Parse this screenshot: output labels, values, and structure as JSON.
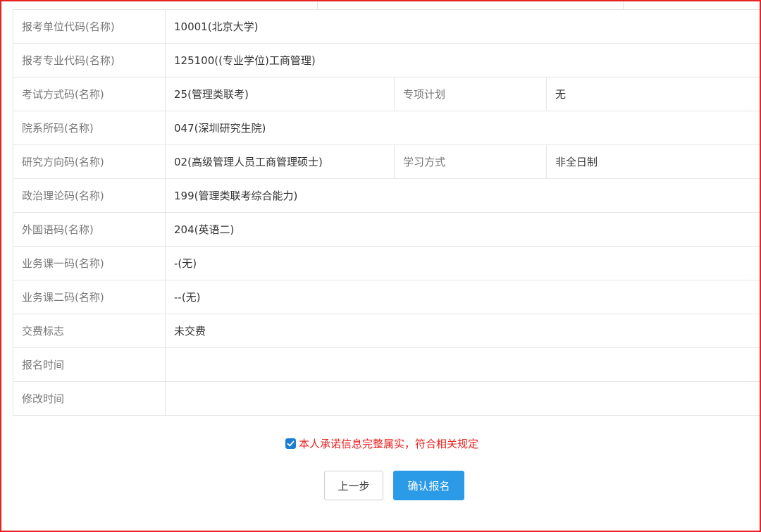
{
  "rows": [
    {
      "label": "报考单位代码(名称)",
      "value": "10001(北京大学)"
    },
    {
      "label": "报考专业代码(名称)",
      "value": "125100((专业学位)工商管理)"
    },
    {
      "label": "考试方式码(名称)",
      "value": "25(管理类联考)",
      "label2": "专项计划",
      "value2": "无"
    },
    {
      "label": "院系所码(名称)",
      "value": "047(深圳研究生院)"
    },
    {
      "label": "研究方向码(名称)",
      "value": "02(高级管理人员工商管理硕士)",
      "label2": "学习方式",
      "value2": "非全日制"
    },
    {
      "label": "政治理论码(名称)",
      "value": "199(管理类联考综合能力)"
    },
    {
      "label": "外国语码(名称)",
      "value": "204(英语二)"
    },
    {
      "label": "业务课一码(名称)",
      "value": "-(无)"
    },
    {
      "label": "业务课二码(名称)",
      "value": "--(无)"
    },
    {
      "label": "交费标志",
      "value": "未交费"
    },
    {
      "label": "报名时间",
      "value": ""
    },
    {
      "label": "修改时间",
      "value": ""
    }
  ],
  "agreement": {
    "text": "本人承诺信息完整属实，符合相关规定",
    "checked": true
  },
  "buttons": {
    "prev_label": "上一步",
    "confirm_label": "确认报名"
  },
  "colors": {
    "border": "#e8201f",
    "primary": "#2b9be8",
    "checkbox": "#1b7ed2",
    "warning_text": "#e8201f"
  },
  "icons": {
    "checkbox": "check-icon"
  }
}
